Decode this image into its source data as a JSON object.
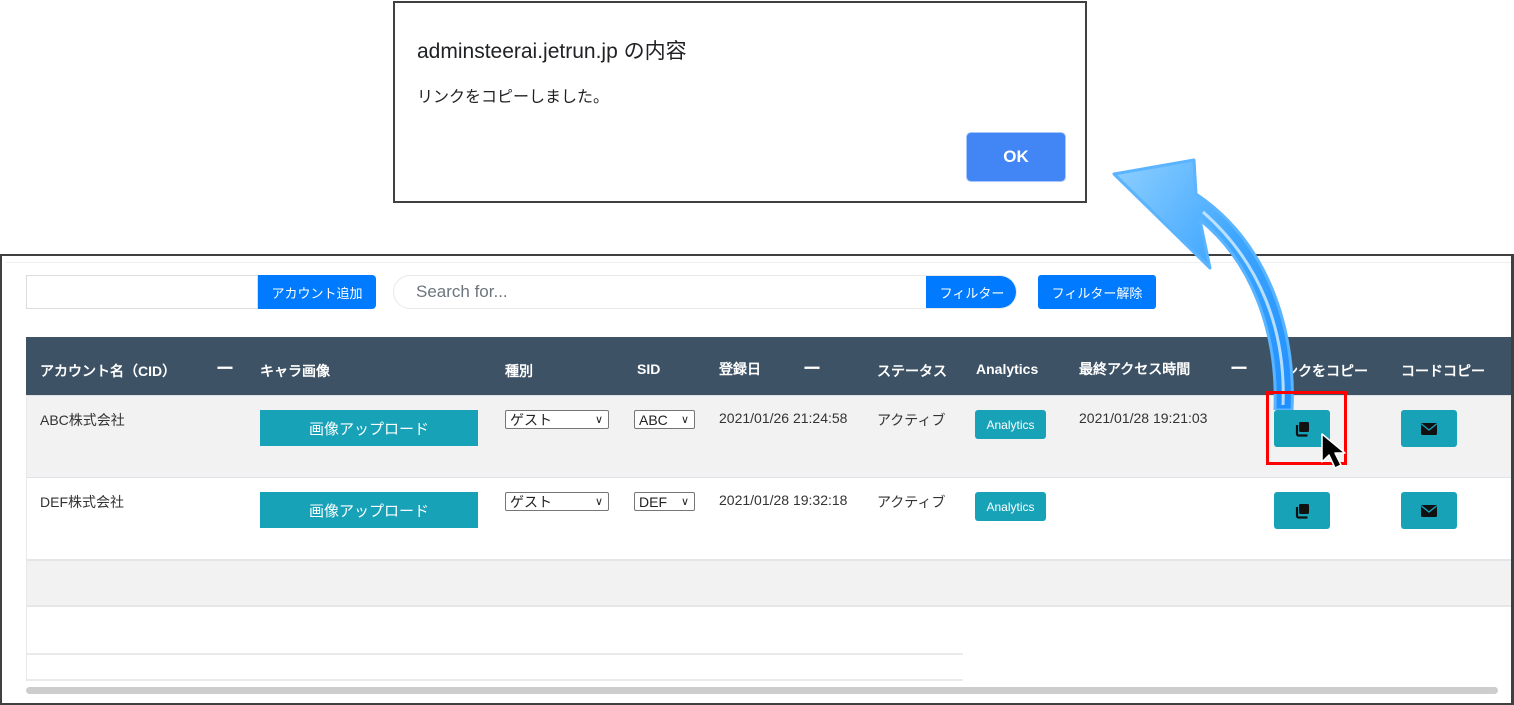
{
  "dialog": {
    "title": "adminsteerai.jetrun.jp の内容",
    "message": "リンクをコピーしました。",
    "ok_label": "OK"
  },
  "toolbar": {
    "account_input_value": "",
    "add_account_label": "アカウント追加",
    "search_placeholder": "Search for...",
    "filter_label": "フィルター",
    "clear_filter_label": "フィルター解除"
  },
  "table": {
    "headers": {
      "account": "アカウント名（CID）",
      "account_sort": "ー",
      "image": "キャラ画像",
      "type": "種別",
      "sid": "SID",
      "registered": "登録日",
      "registered_sort": "ー",
      "status": "ステータス",
      "analytics": "Analytics",
      "last_access": "最終アクセス時間",
      "last_access_sort": "ー",
      "copy_link": "リンクをコピー",
      "copy_code": "コードコピー"
    },
    "rows": [
      {
        "account": "ABC株式会社",
        "upload_label": "画像アップロード",
        "type": "ゲスト",
        "sid": "ABC",
        "registered": "2021/01/26 21:24:58",
        "status": "アクティブ",
        "analytics_label": "Analytics",
        "last_access": "2021/01/28 19:21:03"
      },
      {
        "account": "DEF株式会社",
        "upload_label": "画像アップロード",
        "type": "ゲスト",
        "sid": "DEF",
        "registered": "2021/01/28 19:32:18",
        "status": "アクティブ",
        "analytics_label": "Analytics",
        "last_access": ""
      }
    ]
  },
  "icons": {
    "copy": "copy-icon",
    "mail": "envelope-icon",
    "chevron": "⌄"
  },
  "colors": {
    "primary": "#007bff",
    "teal": "#17a2b8",
    "header_bg": "#3e5265",
    "dialog_ok": "#4285f4",
    "highlight": "#ff0000"
  }
}
